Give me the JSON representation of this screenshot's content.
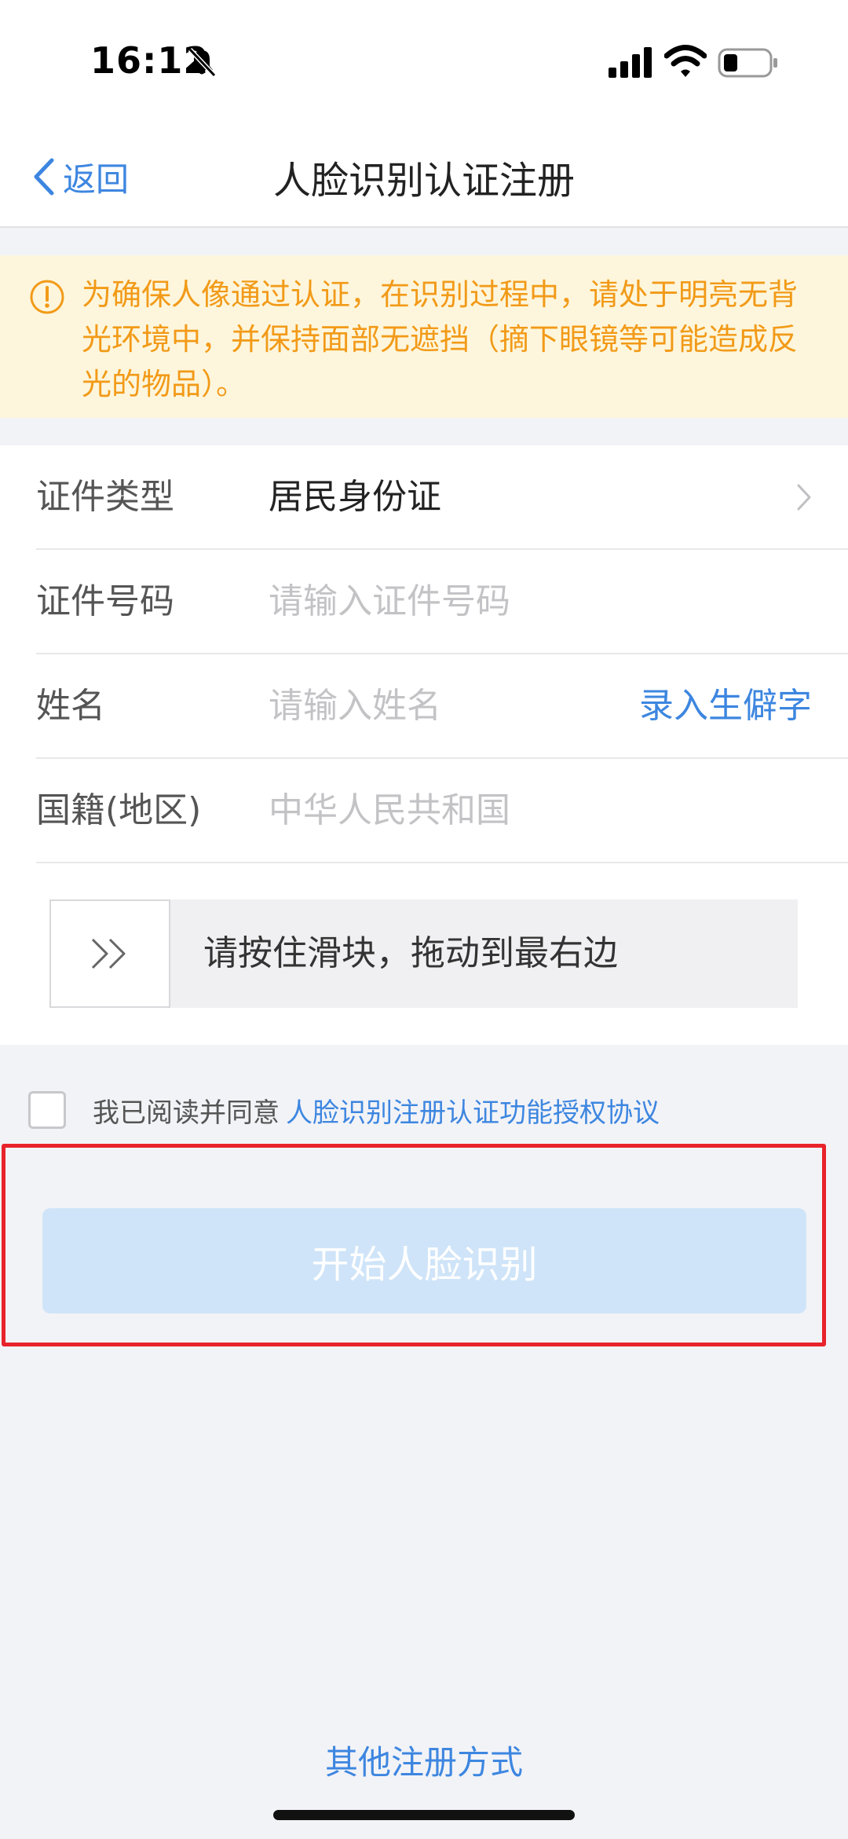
{
  "status_bar": {
    "time": "16:12"
  },
  "nav": {
    "back_label": "返回",
    "title": "人脸识别认证注册"
  },
  "notice": {
    "text": "为确保人像通过认证，在识别过程中，请处于明亮无背光环境中，并保持面部无遮挡（摘下眼镜等可能造成反光的物品）。"
  },
  "form": {
    "id_type": {
      "label": "证件类型",
      "value": "居民身份证"
    },
    "id_number": {
      "label": "证件号码",
      "placeholder": "请输入证件号码"
    },
    "name": {
      "label": "姓名",
      "placeholder": "请输入姓名",
      "rare_char_link": "录入生僻字"
    },
    "nationality": {
      "label": "国籍(地区)",
      "value": "中华人民共和国"
    },
    "slider": {
      "text": "请按住滑块，拖动到最右边"
    }
  },
  "agreement": {
    "prefix": "我已阅读并同意",
    "link": "人脸识别注册认证功能授权协议",
    "checked": false
  },
  "start_button": {
    "label": "开始人脸识别",
    "enabled": false
  },
  "other_methods": {
    "label": "其他注册方式"
  },
  "colors": {
    "accent": "#3d86e0",
    "warning": "#f29a18",
    "warning_bg": "#fdf6dc",
    "highlight": "#e8232b",
    "button_disabled": "#cfe4f8"
  }
}
